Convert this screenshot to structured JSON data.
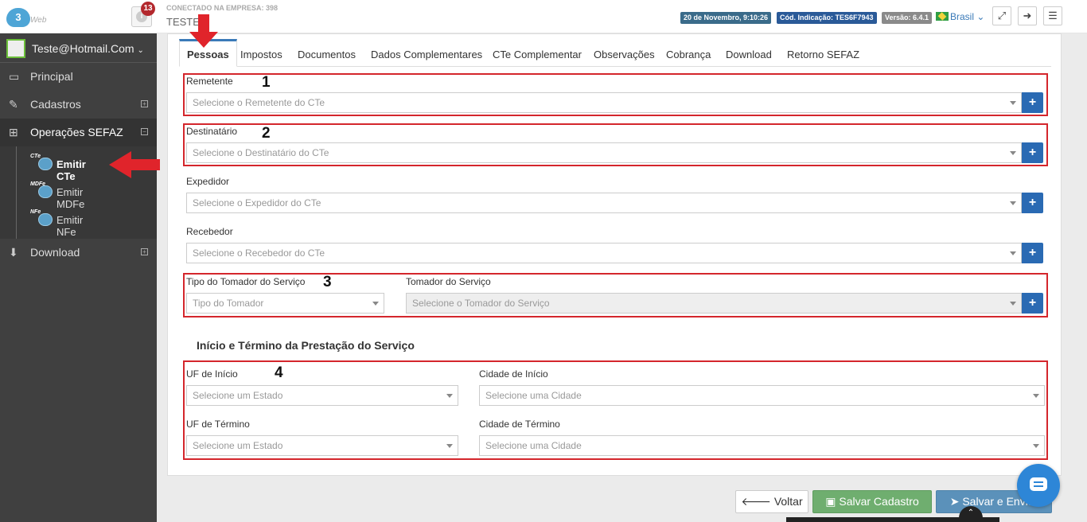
{
  "header": {
    "logo_text": "Web",
    "notifications_count": "13",
    "connection_label": "CONECTADO NA EMPRESA: 398",
    "company_name": "TESTE",
    "date_label": "20 de Novembro, 9:10:26",
    "indicacao_label": "Cód. Indicação: TES6F7943",
    "version_label": "Versão: 6.4.1",
    "language_label": "Brasil"
  },
  "sidebar": {
    "user_email": "Teste@Hotmail.Com",
    "items": [
      {
        "label": "Principal",
        "icon": "laptop-icon"
      },
      {
        "label": "Cadastros",
        "icon": "edit-icon"
      },
      {
        "label": "Operações SEFAZ",
        "icon": "windows-icon"
      },
      {
        "label": "Download",
        "icon": "download-icon"
      }
    ],
    "subitems": [
      {
        "label": "Emitir CTe",
        "badge": "CTe"
      },
      {
        "label": "Emitir MDFe",
        "badge": "MDFe"
      },
      {
        "label": "Emitir NFe",
        "badge": "NFe"
      }
    ]
  },
  "tabs": [
    "Pessoas",
    "Impostos",
    "Documentos",
    "Dados Complementares",
    "CTe Complementar",
    "Observações",
    "Cobrança",
    "Download",
    "Retorno SEFAZ"
  ],
  "form": {
    "remetente_label": "Remetente",
    "remetente_placeholder": "Selecione o Remetente do CTe",
    "destinatario_label": "Destinatário",
    "destinatario_placeholder": "Selecione o Destinatário do CTe",
    "expedidor_label": "Expedidor",
    "expedidor_placeholder": "Selecione o Expedidor do CTe",
    "recebedor_label": "Recebedor",
    "recebedor_placeholder": "Selecione o Recebedor do CTe",
    "tipo_tomador_label": "Tipo do Tomador do Serviço",
    "tipo_tomador_placeholder": "Tipo do Tomador",
    "tomador_label": "Tomador do Serviço",
    "tomador_placeholder": "Selecione o Tomador do Serviço",
    "section_title": "Início e Término da Prestação do Serviço",
    "uf_inicio_label": "UF de Início",
    "uf_inicio_placeholder": "Selecione um Estado",
    "cidade_inicio_label": "Cidade de Início",
    "cidade_inicio_placeholder": "Selecione uma Cidade",
    "uf_termino_label": "UF de Término",
    "uf_termino_placeholder": "Selecione um Estado",
    "cidade_termino_label": "Cidade de Término",
    "cidade_termino_placeholder": "Selecione uma Cidade",
    "plus_label": "+"
  },
  "annotations": [
    "1",
    "2",
    "3",
    "4"
  ],
  "footer": {
    "back_label": "Voltar",
    "save_label": "Salvar Cadastro",
    "send_label": "Salvar e Enviar"
  },
  "colors": {
    "accent": "#2a6ab3",
    "annotation_red": "#d4262c",
    "sidebar_bg": "#404040"
  }
}
